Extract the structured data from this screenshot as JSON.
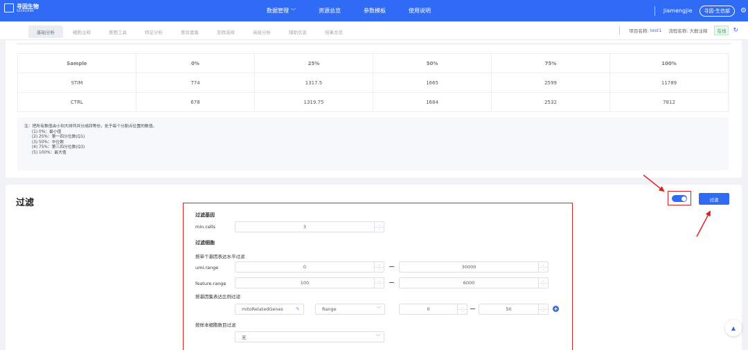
{
  "brand": {
    "cn": "寻因生物",
    "en": "SEEKGENE"
  },
  "topnav": [
    {
      "label": "数据管理",
      "has_dropdown": true
    },
    {
      "label": "资源总览"
    },
    {
      "label": "参数模板"
    },
    {
      "label": "使用说明"
    }
  ],
  "user": {
    "name": "jiamengjie",
    "company": "寻因-生信部"
  },
  "icons": {
    "settings": "gear-icon",
    "refresh": "refresh-icon",
    "back_to_top": "arrow-up-icon",
    "edit": "edit-icon",
    "add": "plus-circle-icon"
  },
  "subtabs": [
    "基础分析",
    "细胞注释",
    "差图工具",
    "特征分析",
    "差异富集",
    "亚群选择",
    "高级分析",
    "辅助信息",
    "结果总览"
  ],
  "project": {
    "project_label": "项目名称:",
    "project_value": "test1",
    "flow_label": "流程名称:",
    "flow_value": "大群注释",
    "status": "在线"
  },
  "quantile_table": {
    "headers": [
      "Sample",
      "0%",
      "25%",
      "50%",
      "75%",
      "100%"
    ],
    "rows": [
      [
        "STIM",
        "774",
        "1317.5",
        "1665",
        "2599",
        "11789"
      ],
      [
        "CTRL",
        "678",
        "1319.75",
        "1684",
        "2532",
        "7812"
      ]
    ]
  },
  "note": {
    "title": "注：把所有数值由小到大排列并分成四等份，处于每个分割点位置的数值。",
    "items": [
      "(1) 0%：最小值",
      "(2) 25%：第一四分位数(Q1)",
      "(3) 50%：中位数",
      "(4) 75%：第三四分位数(Q3)",
      "(5) 100%：最大值"
    ]
  },
  "filter": {
    "section_title": "过滤",
    "toggle_on": true,
    "button_label": "过滤",
    "gene_section": "过滤基因",
    "min_cells_label": "min.cells",
    "min_cells": "3",
    "cell_section": "过滤细胞",
    "per_gene_label": "按单个基因表达水平过滤",
    "umi_label": "umi.range",
    "umi_min": "0",
    "umi_max": "30000",
    "feature_label": "feature.range",
    "feature_min": "100",
    "feature_max": "6000",
    "geneset_label": "按基因集表达比例过滤",
    "geneset_value": "mitoRelatedGenes",
    "mode_value": "Range",
    "ratio_min": "0",
    "ratio_max": "50",
    "per_sample_label": "按样本细胞数目过滤",
    "per_sample_value": "无"
  },
  "colors": {
    "primary": "#2f6bf5",
    "highlight": "#e02020",
    "online": "#2bab58"
  }
}
